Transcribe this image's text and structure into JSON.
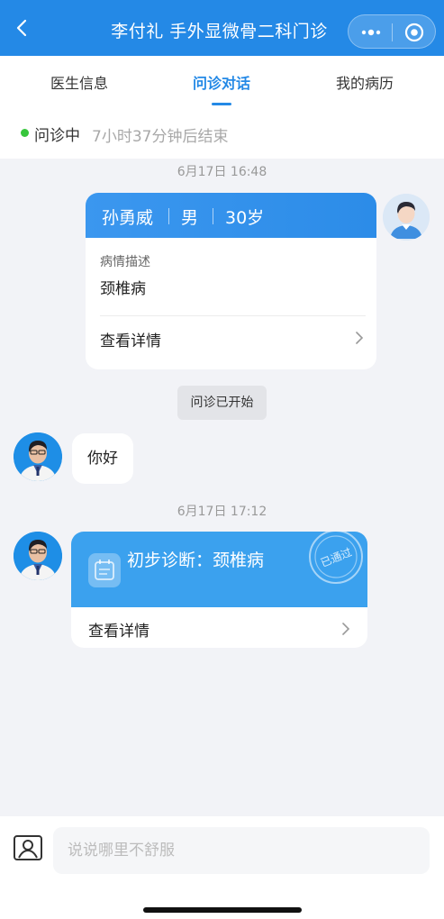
{
  "header": {
    "title": "李付礼 手外显微骨二科门诊",
    "color": "#2489e6"
  },
  "tabs": [
    {
      "label": "医生信息"
    },
    {
      "label": "问诊对话",
      "active": true
    },
    {
      "label": "我的病历"
    }
  ],
  "status": {
    "label": "问诊中",
    "sub": "7小时37分钟后结束",
    "dot_color": "#37c63c"
  },
  "messages": {
    "time1": "6月17日 16:48",
    "patient": {
      "name": "孙勇威",
      "gender": "男",
      "age": "30岁",
      "desc_label": "病情描述",
      "desc_value": "颈椎病",
      "detail_label": "查看详情"
    },
    "system_pill": "问诊已开始",
    "doctor_greeting": "你好",
    "time2": "6月17日 17:12",
    "diagnosis": {
      "text": "初步诊断：颈椎病",
      "stamp": "已通过",
      "detail_label": "查看详情"
    }
  },
  "input": {
    "placeholder": "说说哪里不舒服"
  }
}
